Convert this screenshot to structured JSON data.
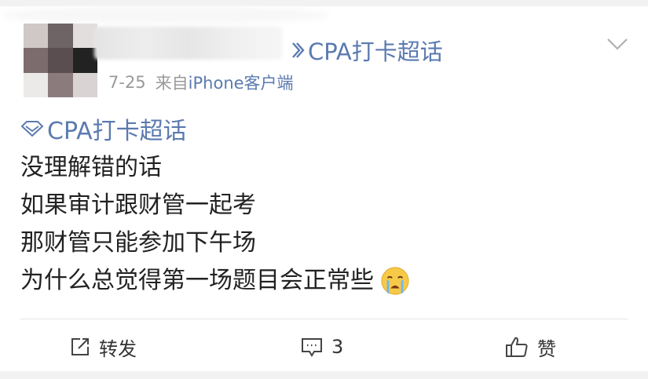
{
  "post": {
    "super_topic_label": "CPA打卡超话",
    "meta": {
      "date": "7-25",
      "source_prefix": "来自",
      "source_link": "iPhone客户端"
    },
    "topic_tag": "CPA打卡超话",
    "content_lines": [
      "没理解错的话",
      "如果审计跟财管一起考",
      "那财管只能参加下午场",
      "为什么总觉得第一场题目会正常些"
    ],
    "emoji": "crying-face-icon"
  },
  "actions": {
    "repost_label": "转发",
    "comment_count": "3",
    "like_label": "赞"
  },
  "colors": {
    "link": "#5b7ab0",
    "text": "#222222",
    "meta": "#999999"
  }
}
